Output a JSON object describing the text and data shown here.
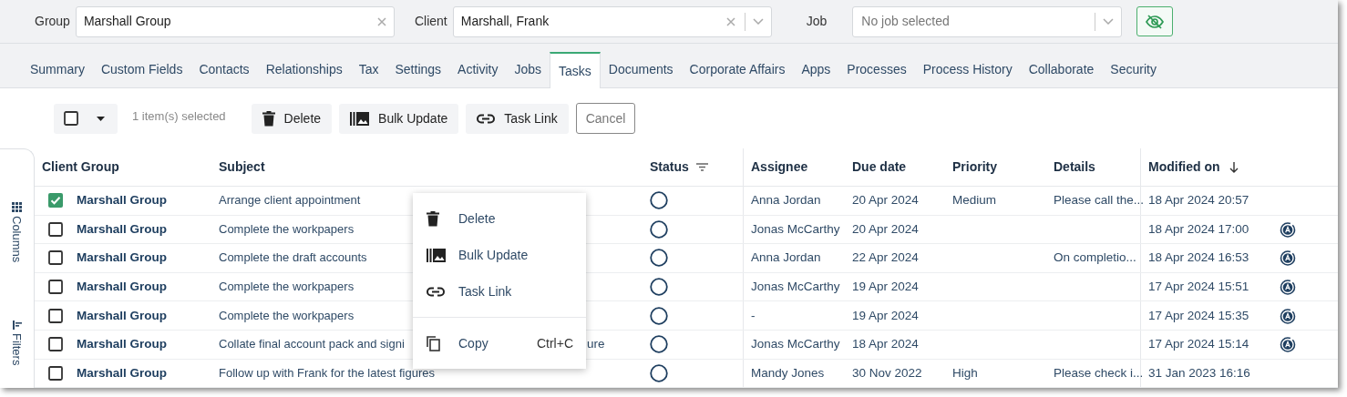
{
  "filters": [
    {
      "label": "Group",
      "value": "Marshall Group",
      "dropdown": false
    },
    {
      "label": "Client",
      "value": "Marshall, Frank",
      "dropdown": true
    }
  ],
  "job": {
    "label": "Job",
    "placeholder": "No job selected"
  },
  "tabs": [
    {
      "label": "Summary",
      "selected": false
    },
    {
      "label": "Custom Fields",
      "selected": false
    },
    {
      "label": "Contacts",
      "selected": false
    },
    {
      "label": "Relationships",
      "selected": false
    },
    {
      "label": "Tax",
      "selected": false
    },
    {
      "label": "Settings",
      "selected": false
    },
    {
      "label": "Activity",
      "selected": false
    },
    {
      "label": "Jobs",
      "selected": false
    },
    {
      "label": "Tasks",
      "selected": true
    },
    {
      "label": "Documents",
      "selected": false
    },
    {
      "label": "Corporate Affairs",
      "selected": false
    },
    {
      "label": "Apps",
      "selected": false
    },
    {
      "label": "Processes",
      "selected": false
    },
    {
      "label": "Process History",
      "selected": false
    },
    {
      "label": "Collaborate",
      "selected": false
    },
    {
      "label": "Security",
      "selected": false
    }
  ],
  "toolbar": {
    "select_all_checked": false,
    "selection_count": "1 item(s) selected",
    "buttons": [
      {
        "kind": "delete",
        "label": "Delete"
      },
      {
        "kind": "bulk",
        "label": "Bulk Update"
      },
      {
        "kind": "link",
        "label": "Task Link"
      },
      {
        "kind": "cancel",
        "label": "Cancel"
      }
    ]
  },
  "side_panels": [
    "Columns",
    "Filters"
  ],
  "table": {
    "columns": [
      "Client Group",
      "Subject",
      "Status",
      "Assignee",
      "Due date",
      "Priority",
      "Details",
      "Modified on"
    ],
    "rows": [
      {
        "checked": true,
        "client_group": "Marshall Group",
        "subject": "Arrange client appointment",
        "assignee": "Anna Jordan",
        "due_date": "20 Apr 2024",
        "priority": "Medium",
        "details": "Please call the...",
        "modified_on": "18 Apr 2024 20:57",
        "automated": false
      },
      {
        "checked": false,
        "client_group": "Marshall Group",
        "subject": "Complete the workpapers",
        "assignee": "Jonas McCarthy",
        "due_date": "20 Apr 2024",
        "modified_on": "18 Apr 2024 17:00",
        "automated": true
      },
      {
        "checked": false,
        "client_group": "Marshall Group",
        "subject": "Complete the draft accounts",
        "assignee": "Anna Jordan",
        "due_date": "22 Apr 2024",
        "details": "On completio...",
        "modified_on": "18 Apr 2024 16:53",
        "automated": true
      },
      {
        "checked": false,
        "client_group": "Marshall Group",
        "subject": "Complete the workpapers",
        "assignee": "Jonas McCarthy",
        "due_date": "19 Apr 2024",
        "modified_on": "17 Apr 2024 15:51",
        "automated": true
      },
      {
        "checked": false,
        "client_group": "Marshall Group",
        "subject": "Complete the workpapers",
        "assignee": "-",
        "due_date": "19 Apr 2024",
        "modified_on": "17 Apr 2024 15:35",
        "automated": true
      },
      {
        "checked": false,
        "client_group": "Marshall Group",
        "subject": "Collate final account pack and signi",
        "subject_tail": "ure",
        "assignee": "Jonas McCarthy",
        "due_date": "18 Apr 2024",
        "modified_on": "17 Apr 2024 15:14",
        "automated": true
      },
      {
        "checked": false,
        "client_group": "Marshall Group",
        "subject": "Follow up with Frank for the latest figures",
        "assignee": "Mandy Jones",
        "due_date": "30 Nov 2022",
        "priority": "High",
        "details": "Please check i...",
        "modified_on": "31 Jan 2023 16:16",
        "automated": false
      }
    ]
  },
  "context_menu": [
    {
      "kind": "delete",
      "label": "Delete"
    },
    {
      "kind": "bulk",
      "label": "Bulk Update"
    },
    {
      "kind": "link",
      "label": "Task Link"
    },
    {
      "kind": "copy",
      "label": "Copy",
      "shortcut": "Ctrl+C"
    }
  ]
}
